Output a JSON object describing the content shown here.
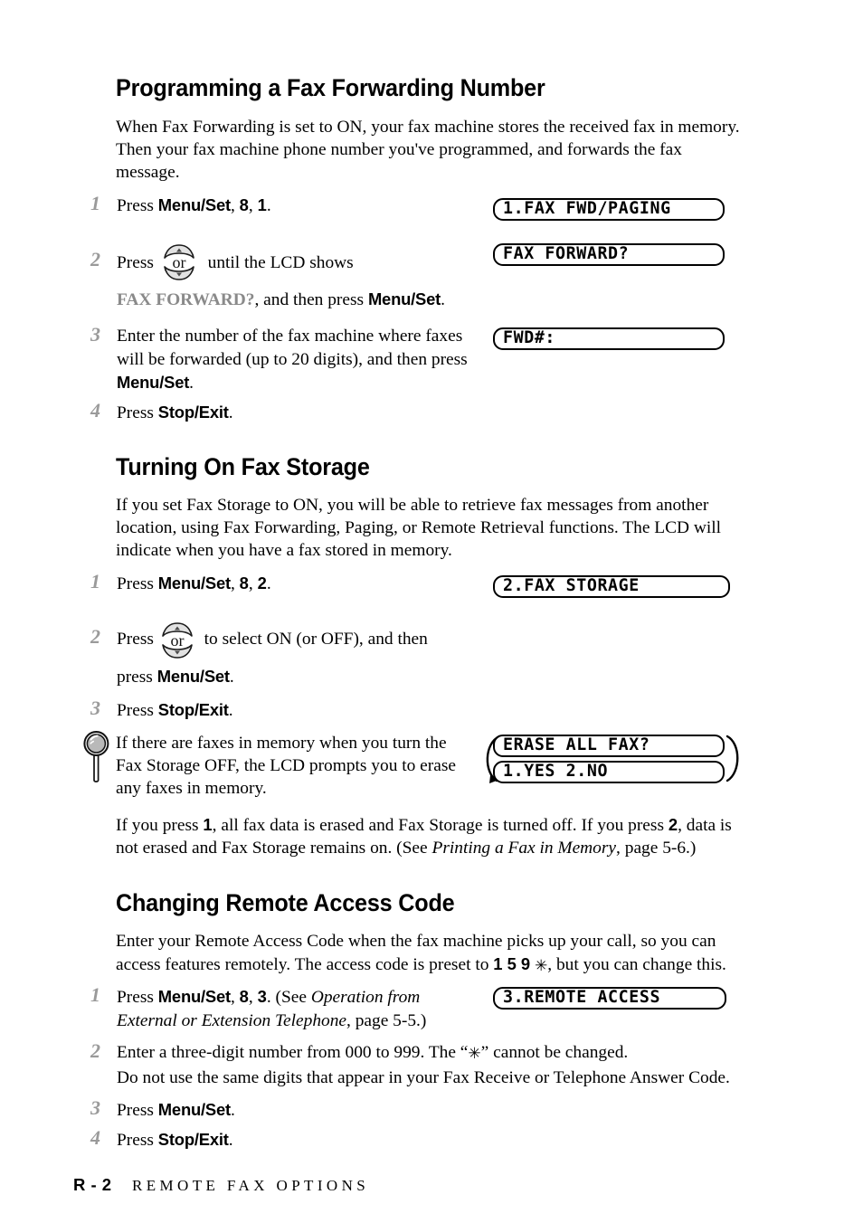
{
  "document": {
    "footer": {
      "page_number": "R - 2",
      "section_title": "REMOTE FAX OPTIONS"
    }
  },
  "sections": [
    {
      "heading": "Programming a Fax Forwarding Number",
      "intro": "When Fax Forwarding is set to ON, your fax machine stores the received fax in memory. Then your fax machine phone number you've programmed, and forwards the fax message.",
      "steps": [
        {
          "number": "1",
          "text_lead": "Press ",
          "bold1": "Menu/Set",
          "mid1": ", ",
          "bold2": "8",
          "mid2": ", ",
          "bold3": "1",
          "tail": "."
        },
        {
          "number": "2",
          "line1_pre": "Press ",
          "line1_post": " until the LCD shows",
          "line2_gray": "FAX FORWARD?",
          "line2_mid": ", and then press ",
          "line2_bold": "Menu/Set",
          "line2_tail": "."
        },
        {
          "number": "3",
          "text": "Enter the number of the fax machine where faxes will be forwarded (up to 20 digits), and then press ",
          "bold": "Menu/Set",
          "tail": "."
        },
        {
          "number": "4",
          "text": "Press ",
          "bold": "Stop/Exit",
          "tail": "."
        }
      ],
      "lcds": [
        {
          "text": "1.FAX FWD/PAGING"
        },
        {
          "text": "FAX FORWARD?"
        },
        {
          "text": "FWD#:"
        }
      ]
    },
    {
      "heading": "Turning On Fax Storage",
      "intro": "If you set Fax Storage to ON, you will be able to retrieve fax messages from another location, using Fax Forwarding, Paging, or Remote Retrieval functions. The LCD will indicate when you have a fax stored in memory.",
      "steps": [
        {
          "number": "1",
          "text_lead": "Press ",
          "bold1": "Menu/Set",
          "mid1": ", ",
          "bold2": "8",
          "mid2": ", ",
          "bold3": "2",
          "tail": "."
        },
        {
          "number": "2",
          "line1_pre": "Press ",
          "line1_post": " to select ON (or OFF), and then",
          "line2_pre": "press ",
          "line2_bold": "Menu/Set",
          "line2_tail": "."
        },
        {
          "number": "3",
          "text": "Press ",
          "bold": "Stop/Exit",
          "tail": "."
        }
      ],
      "tip": {
        "icon": "magnifier-icon",
        "text": "If there are faxes in memory when you turn the Fax Storage OFF, the LCD prompts you to erase any faxes in memory."
      },
      "lcds": [
        {
          "text": "2.FAX STORAGE"
        }
      ],
      "lcd_pair": [
        {
          "text": "ERASE ALL FAX?"
        },
        {
          "text": "1.YES 2.NO"
        }
      ],
      "outro_a": "If you press ",
      "outro_bold1": "1",
      "outro_b": ", all fax data is erased and Fax Storage is turned off.  If you press ",
      "outro_bold2": "2",
      "outro_c": ", data is not erased and Fax Storage remains on. (See ",
      "outro_italic": "Printing a Fax in Memory",
      "outro_d": ", page 5-6.)"
    },
    {
      "heading": "Changing Remote Access Code",
      "intro_a": "Enter your Remote Access Code when the fax machine picks up your call, so you can access features remotely.  The access code is preset to ",
      "intro_code": "1 5 9",
      "intro_star": "✳",
      "intro_b": ", but you can change this.",
      "steps": [
        {
          "number": "1",
          "lead": "Press ",
          "bold1": "Menu/Set",
          "mid1": ", ",
          "bold2": "8",
          "mid2": ", ",
          "bold3": "3",
          "mid3": ". (See ",
          "italic": "Operation from External or Extension Telephone",
          "tail": ", page 5-5.)"
        },
        {
          "number": "2",
          "line1a": "Enter a three-digit number from 000 to 999. The “",
          "line1star": "✳",
          "line1b": "” cannot be changed.",
          "line2": "Do not use the same digits that appear in your Fax Receive or Telephone Answer Code."
        },
        {
          "number": "3",
          "text": "Press ",
          "bold": "Menu/Set",
          "tail": "."
        },
        {
          "number": "4",
          "text": "Press ",
          "bold": "Stop/Exit",
          "tail": "."
        }
      ],
      "lcds": [
        {
          "text": "3.REMOTE ACCESS"
        }
      ]
    }
  ],
  "icons": {
    "updown_key_label": "or",
    "updown_up": "▲",
    "updown_down": "▼"
  }
}
